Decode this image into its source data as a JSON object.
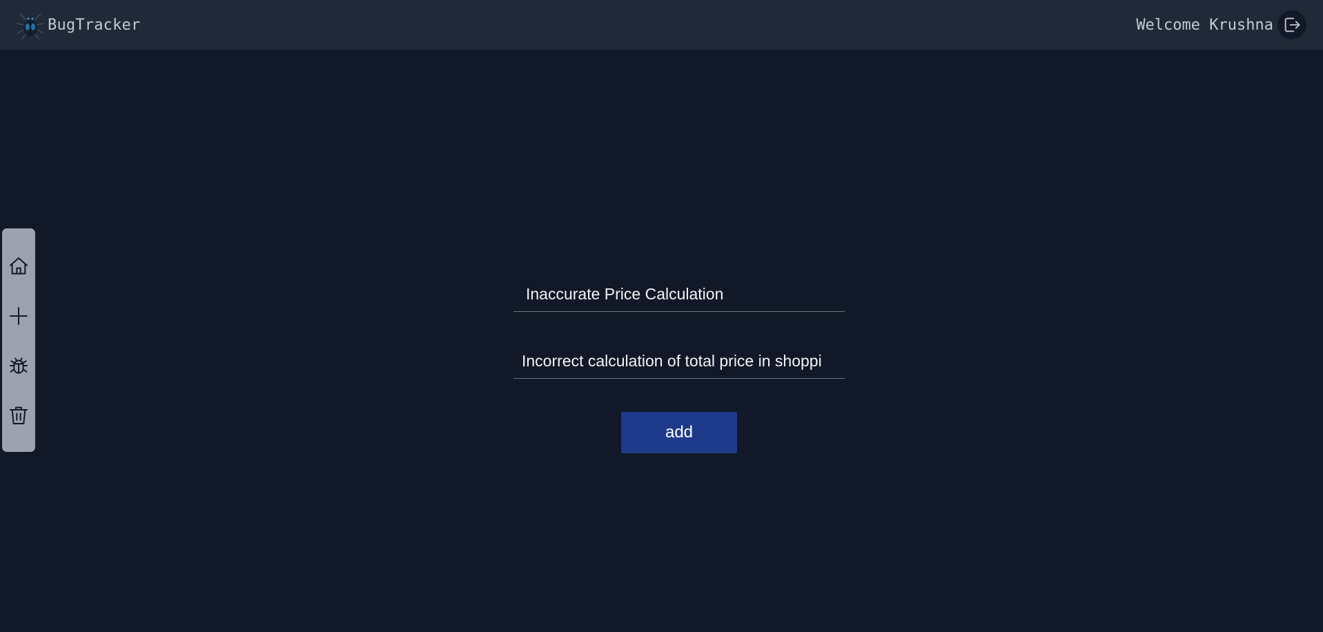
{
  "header": {
    "app_name": "BugTracker",
    "welcome_text": "Welcome Krushna",
    "logo_icon": "bug-logo-icon",
    "logout_icon": "logout-icon",
    "background_color": "#1f2937"
  },
  "sidebar": {
    "background_color": "#9ca3af",
    "items": [
      {
        "icon": "home-icon"
      },
      {
        "icon": "plus-icon"
      },
      {
        "icon": "bug-icon"
      },
      {
        "icon": "trash-icon"
      }
    ]
  },
  "form": {
    "title_value": "Inaccurate Price Calculation",
    "description_value": "Incorrect calculation of total price in shoppi",
    "add_label": "add",
    "button_color": "#1e3a8a"
  },
  "page": {
    "background_color": "#111827"
  }
}
